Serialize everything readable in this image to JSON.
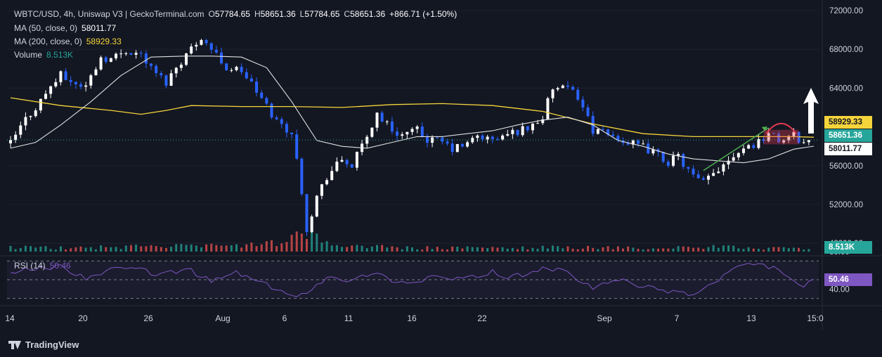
{
  "header": {
    "symbol_line": "WBTC/USD, 4h, Uniswap V3 | GeckoTerminal.com",
    "open_label": "O",
    "open": "57784.65",
    "high_label": "H",
    "high": "58651.36",
    "low_label": "L",
    "low": "57784.65",
    "close_label": "C",
    "close": "58651.36",
    "change": "+866.71 (+1.50%)",
    "ma50_label": "MA (50, close, 0)",
    "ma50_value": "58011.77",
    "ma200_label": "MA (200, close, 0)",
    "ma200_value": "58929.33",
    "volume_label": "Volume",
    "volume_value": "8.513K",
    "rsi_label": "RSI (14)",
    "rsi_value": "50.46"
  },
  "badges": {
    "ma200": "58929.33",
    "price": "58651.36",
    "ma50": "58011.77",
    "volume": "8.513K",
    "rsi": "50.46"
  },
  "branding": {
    "name": "TradingView"
  },
  "colors": {
    "background": "#131722",
    "up": "#ffffff",
    "down": "#2962ff",
    "ma50": "#e0e0e0",
    "ma200": "#f5d43b",
    "rsi": "#7e57c2",
    "price_badge": "#26a69a",
    "volume_up": "#26a69a",
    "volume_down": "#ef5350",
    "annotation_arrow": "#4caf50",
    "annotation_top": "#e53950"
  },
  "chart_data": {
    "type": "candlestick",
    "y_ticks": [
      "72000.00",
      "68000.00",
      "64000.00",
      "56000.00",
      "52000.00",
      "48000.00"
    ],
    "ylim": [
      47000,
      72500
    ],
    "x_ticks": [
      "14",
      "20",
      "26",
      "Aug",
      "6",
      "11",
      "16",
      "22",
      "Sep",
      "7",
      "13",
      "15:0"
    ],
    "rsi_ticks": [
      "80.00",
      "40.00"
    ],
    "rsi_levels": [
      70,
      50,
      30
    ],
    "rsi_range": [
      20,
      80
    ],
    "close_path": [
      [
        0,
        58300
      ],
      [
        3,
        60800
      ],
      [
        5,
        62000
      ],
      [
        8,
        64200
      ],
      [
        10,
        65300
      ],
      [
        13,
        64400
      ],
      [
        15,
        64200
      ],
      [
        18,
        67200
      ],
      [
        20,
        67000
      ],
      [
        23,
        67900
      ],
      [
        26,
        67500
      ],
      [
        28,
        66000
      ],
      [
        31,
        64600
      ],
      [
        33,
        66200
      ],
      [
        36,
        68100
      ],
      [
        38,
        69300
      ],
      [
        41,
        67400
      ],
      [
        43,
        66100
      ],
      [
        46,
        65800
      ],
      [
        48,
        64400
      ],
      [
        51,
        62100
      ],
      [
        53,
        60600
      ],
      [
        56,
        59400
      ],
      [
        58,
        53500
      ],
      [
        59,
        49500
      ],
      [
        61,
        52800
      ],
      [
        63,
        54900
      ],
      [
        66,
        56600
      ],
      [
        68,
        56000
      ],
      [
        71,
        59000
      ],
      [
        73,
        61400
      ],
      [
        76,
        59700
      ],
      [
        78,
        59200
      ],
      [
        81,
        59600
      ],
      [
        83,
        58700
      ],
      [
        86,
        58400
      ],
      [
        88,
        57700
      ],
      [
        91,
        58200
      ],
      [
        93,
        59100
      ],
      [
        96,
        58600
      ],
      [
        98,
        59000
      ],
      [
        101,
        59600
      ],
      [
        103,
        59900
      ],
      [
        106,
        61000
      ],
      [
        108,
        64000
      ],
      [
        111,
        63800
      ],
      [
        113,
        63200
      ],
      [
        116,
        59700
      ],
      [
        118,
        59300
      ],
      [
        121,
        58900
      ],
      [
        123,
        58300
      ],
      [
        126,
        57900
      ],
      [
        128,
        57400
      ],
      [
        131,
        56400
      ],
      [
        133,
        56900
      ],
      [
        136,
        54800
      ],
      [
        138,
        54200
      ],
      [
        141,
        55700
      ],
      [
        143,
        56800
      ],
      [
        146,
        57900
      ],
      [
        148,
        58200
      ],
      [
        151,
        59300
      ],
      [
        153,
        58600
      ],
      [
        156,
        59100
      ],
      [
        158,
        58400
      ],
      [
        160,
        58651
      ]
    ],
    "ma50_path": [
      [
        0,
        57800
      ],
      [
        5,
        58400
      ],
      [
        10,
        60200
      ],
      [
        16,
        62600
      ],
      [
        22,
        65300
      ],
      [
        28,
        67200
      ],
      [
        35,
        67300
      ],
      [
        40,
        67300
      ],
      [
        46,
        67200
      ],
      [
        51,
        66100
      ],
      [
        56,
        62600
      ],
      [
        61,
        58600
      ],
      [
        66,
        58000
      ],
      [
        71,
        57800
      ],
      [
        76,
        58400
      ],
      [
        81,
        59000
      ],
      [
        86,
        59000
      ],
      [
        91,
        59300
      ],
      [
        96,
        59600
      ],
      [
        101,
        60200
      ],
      [
        106,
        60700
      ],
      [
        111,
        61000
      ],
      [
        116,
        60200
      ],
      [
        121,
        58600
      ],
      [
        126,
        58000
      ],
      [
        131,
        57200
      ],
      [
        136,
        56700
      ],
      [
        141,
        56500
      ],
      [
        146,
        56300
      ],
      [
        151,
        56700
      ],
      [
        156,
        57700
      ],
      [
        160,
        58012
      ]
    ],
    "ma200_path": [
      [
        0,
        63000
      ],
      [
        10,
        62200
      ],
      [
        20,
        61700
      ],
      [
        26,
        61300
      ],
      [
        31,
        61700
      ],
      [
        36,
        62200
      ],
      [
        46,
        62100
      ],
      [
        56,
        62100
      ],
      [
        66,
        62000
      ],
      [
        76,
        62300
      ],
      [
        86,
        62400
      ],
      [
        96,
        62200
      ],
      [
        106,
        61600
      ],
      [
        116,
        60300
      ],
      [
        126,
        59300
      ],
      [
        136,
        59000
      ],
      [
        146,
        59000
      ],
      [
        156,
        59000
      ],
      [
        160,
        58929
      ]
    ],
    "rsi_path": [
      [
        0,
        58
      ],
      [
        5,
        62
      ],
      [
        10,
        64
      ],
      [
        15,
        52
      ],
      [
        20,
        60
      ],
      [
        25,
        62
      ],
      [
        30,
        55
      ],
      [
        35,
        62
      ],
      [
        40,
        48
      ],
      [
        45,
        58
      ],
      [
        50,
        46
      ],
      [
        54,
        38
      ],
      [
        57,
        30
      ],
      [
        60,
        42
      ],
      [
        64,
        55
      ],
      [
        68,
        48
      ],
      [
        72,
        58
      ],
      [
        76,
        50
      ],
      [
        80,
        46
      ],
      [
        84,
        54
      ],
      [
        88,
        50
      ],
      [
        92,
        52
      ],
      [
        96,
        58
      ],
      [
        100,
        52
      ],
      [
        104,
        60
      ],
      [
        108,
        62
      ],
      [
        112,
        54
      ],
      [
        116,
        40
      ],
      [
        120,
        50
      ],
      [
        124,
        46
      ],
      [
        128,
        40
      ],
      [
        132,
        38
      ],
      [
        136,
        34
      ],
      [
        140,
        46
      ],
      [
        144,
        62
      ],
      [
        148,
        66
      ],
      [
        151,
        64
      ],
      [
        154,
        58
      ],
      [
        157,
        42
      ],
      [
        160,
        50.46
      ]
    ],
    "volume_profile": [
      [
        0,
        0.25
      ],
      [
        10,
        0.2
      ],
      [
        20,
        0.25
      ],
      [
        30,
        0.3
      ],
      [
        40,
        0.3
      ],
      [
        50,
        0.35
      ],
      [
        55,
        0.6
      ],
      [
        58,
        1.0
      ],
      [
        60,
        0.8
      ],
      [
        65,
        0.35
      ],
      [
        70,
        0.3
      ],
      [
        80,
        0.2
      ],
      [
        90,
        0.2
      ],
      [
        100,
        0.2
      ],
      [
        110,
        0.25
      ],
      [
        120,
        0.2
      ],
      [
        130,
        0.2
      ],
      [
        140,
        0.25
      ],
      [
        150,
        0.2
      ],
      [
        160,
        0.15
      ]
    ],
    "candle_count": 160
  }
}
